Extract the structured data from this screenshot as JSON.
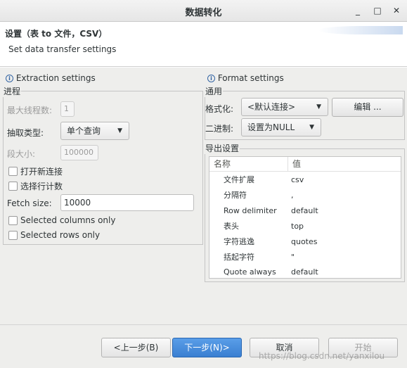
{
  "window": {
    "title": "数据转化",
    "minimize_icon": "minimize-icon",
    "maximize_icon": "maximize-icon",
    "close_icon": "close-icon"
  },
  "header": {
    "title": "设置（表 to 文件，CSV）",
    "description": "Set data transfer settings"
  },
  "extraction": {
    "section_title": "Extraction settings",
    "group_label": "进程",
    "max_threads_label": "最大线程数:",
    "max_threads_value": "1",
    "fetch_type_label": "抽取类型:",
    "fetch_type_value": "单个查询",
    "segment_size_label": "段大小:",
    "segment_size_value": "100000",
    "open_new_conn_label": "打开新连接",
    "select_row_count_label": "选择行计数",
    "fetch_size_label": "Fetch size:",
    "fetch_size_value": "10000",
    "selected_columns_label": "Selected columns only",
    "selected_rows_label": "Selected rows only"
  },
  "format": {
    "section_title": "Format settings",
    "group_label": "通用",
    "formatting_label": "格式化:",
    "formatting_value": "<默认连接>",
    "edit_button": "编辑 ...",
    "binary_label": "二进制:",
    "binary_value": "设置为NULL",
    "export_group_label": "导出设置",
    "table": {
      "columns": [
        "名称",
        "值"
      ],
      "rows": [
        {
          "name": "文件扩展",
          "value": "csv"
        },
        {
          "name": "分隔符",
          "value": ","
        },
        {
          "name": "Row delimiter",
          "value": "default"
        },
        {
          "name": "表头",
          "value": "top"
        },
        {
          "name": "字符逃逸",
          "value": "quotes"
        },
        {
          "name": "括起字符",
          "value": "\""
        },
        {
          "name": "Quote always",
          "value": "default"
        }
      ]
    }
  },
  "footer": {
    "back_button": "<上一步(B)",
    "next_button": "下一步(N)>",
    "cancel_button": "取消",
    "start_button": "开始",
    "watermark": "https://blog.csdn.net/yanxilou"
  },
  "colors": {
    "primary_button": "#3a7fd1",
    "info_icon": "#3465a4",
    "background": "#eeeeec"
  }
}
